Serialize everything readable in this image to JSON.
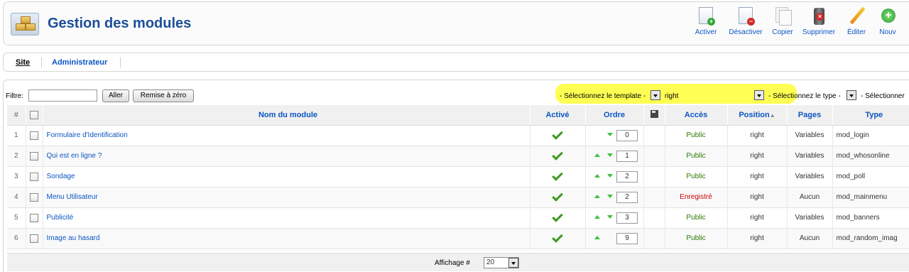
{
  "header": {
    "title": "Gestion des modules",
    "toolbar": [
      {
        "label": "Activer",
        "icon": "enable-icon"
      },
      {
        "label": "Désactiver",
        "icon": "disable-icon"
      },
      {
        "label": "Copier",
        "icon": "copy-icon"
      },
      {
        "label": "Supprimer",
        "icon": "trash-icon"
      },
      {
        "label": "Éditer",
        "icon": "edit-icon"
      },
      {
        "label": "Nouv",
        "icon": "new-icon"
      }
    ]
  },
  "submenu": {
    "site": "Site",
    "admin": "Administrateur"
  },
  "filter": {
    "label": "Filtre:",
    "value": "",
    "go": "Aller",
    "reset": "Remise à zéro",
    "template_placeholder": "- Sélectionnez le template -",
    "position_value": "right",
    "type_placeholder": "- Sélectionnez le type -",
    "state_placeholder": "- Sélectionner"
  },
  "table": {
    "headers": {
      "num": "#",
      "name": "Nom du module",
      "active": "Activé",
      "order": "Ordre",
      "access": "Accès",
      "position": "Position",
      "pages": "Pages",
      "type": "Type"
    },
    "rows": [
      {
        "num": "1",
        "name": "Formulaire d'Identification",
        "order": "0",
        "access": "Public",
        "position": "right",
        "pages": "Variables",
        "type": "mod_login"
      },
      {
        "num": "2",
        "name": "Qui est en ligne ?",
        "order": "1",
        "access": "Public",
        "position": "right",
        "pages": "Variables",
        "type": "mod_whosonline"
      },
      {
        "num": "3",
        "name": "Sondage",
        "order": "2",
        "access": "Public",
        "position": "right",
        "pages": "Variables",
        "type": "mod_poll"
      },
      {
        "num": "4",
        "name": "Menu Utilisateur",
        "order": "2",
        "access": "Enregistré",
        "position": "right",
        "pages": "Aucun",
        "type": "mod_mainmenu"
      },
      {
        "num": "5",
        "name": "Publicité",
        "order": "3",
        "access": "Public",
        "position": "right",
        "pages": "Variables",
        "type": "mod_banners"
      },
      {
        "num": "6",
        "name": "Image au hasard",
        "order": "9",
        "access": "Public",
        "position": "right",
        "pages": "Aucun",
        "type": "mod_random_imag"
      }
    ]
  },
  "footer": {
    "label": "Affichage #",
    "value": "20"
  },
  "colors": {
    "accent": "#0b55c4",
    "title": "#1c4e99",
    "public": "#2d7a00",
    "registered": "#cc0000",
    "highlight": "#ffff40"
  }
}
